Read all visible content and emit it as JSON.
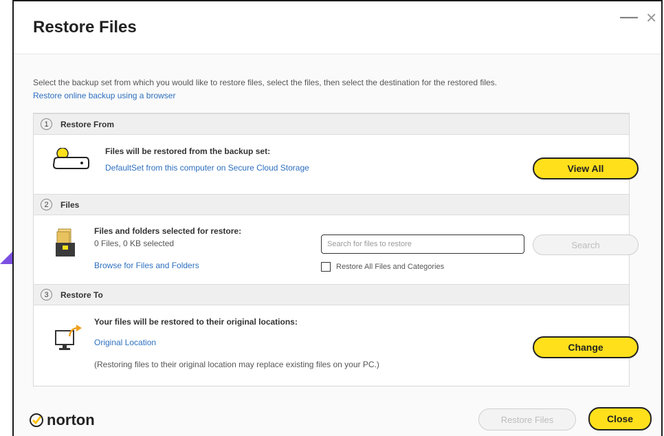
{
  "window": {
    "title": "Restore Files",
    "minimize_label": "—",
    "close_label": "✕"
  },
  "intro": {
    "text": "Select the backup set from which you would like to restore files, select the files, then select the destination for the restored files.",
    "link": "Restore online backup using a browser"
  },
  "sections": {
    "restore_from": {
      "number": "1",
      "label": "Restore From",
      "heading": "Files will be restored from the backup set:",
      "link": "DefaultSet from this computer on Secure Cloud Storage",
      "button": "View All",
      "icon": "hard-drive-icon"
    },
    "files": {
      "number": "2",
      "label": "Files",
      "heading": "Files and folders selected for restore:",
      "count": "0 Files, 0 KB selected",
      "link": "Browse for Files and Folders",
      "search_placeholder": "Search for files to restore",
      "search_value": "",
      "search_button": "Search",
      "checkbox_label": "Restore All Files and Categories",
      "checkbox_checked": false,
      "icon": "files-folder-icon"
    },
    "restore_to": {
      "number": "3",
      "label": "Restore To",
      "heading": "Your files will be restored to their original locations:",
      "link": "Original Location",
      "note": "(Restoring files to their original location may replace existing files on your PC.)",
      "button": "Change",
      "icon": "monitor-restore-icon"
    }
  },
  "footer": {
    "brand": "norton",
    "restore_button": "Restore Files",
    "close_button": "Close"
  },
  "colors": {
    "accent_yellow": "#ffe01b",
    "link_blue": "#2d6fbf",
    "arrow_purple": "#7b4fe0"
  }
}
